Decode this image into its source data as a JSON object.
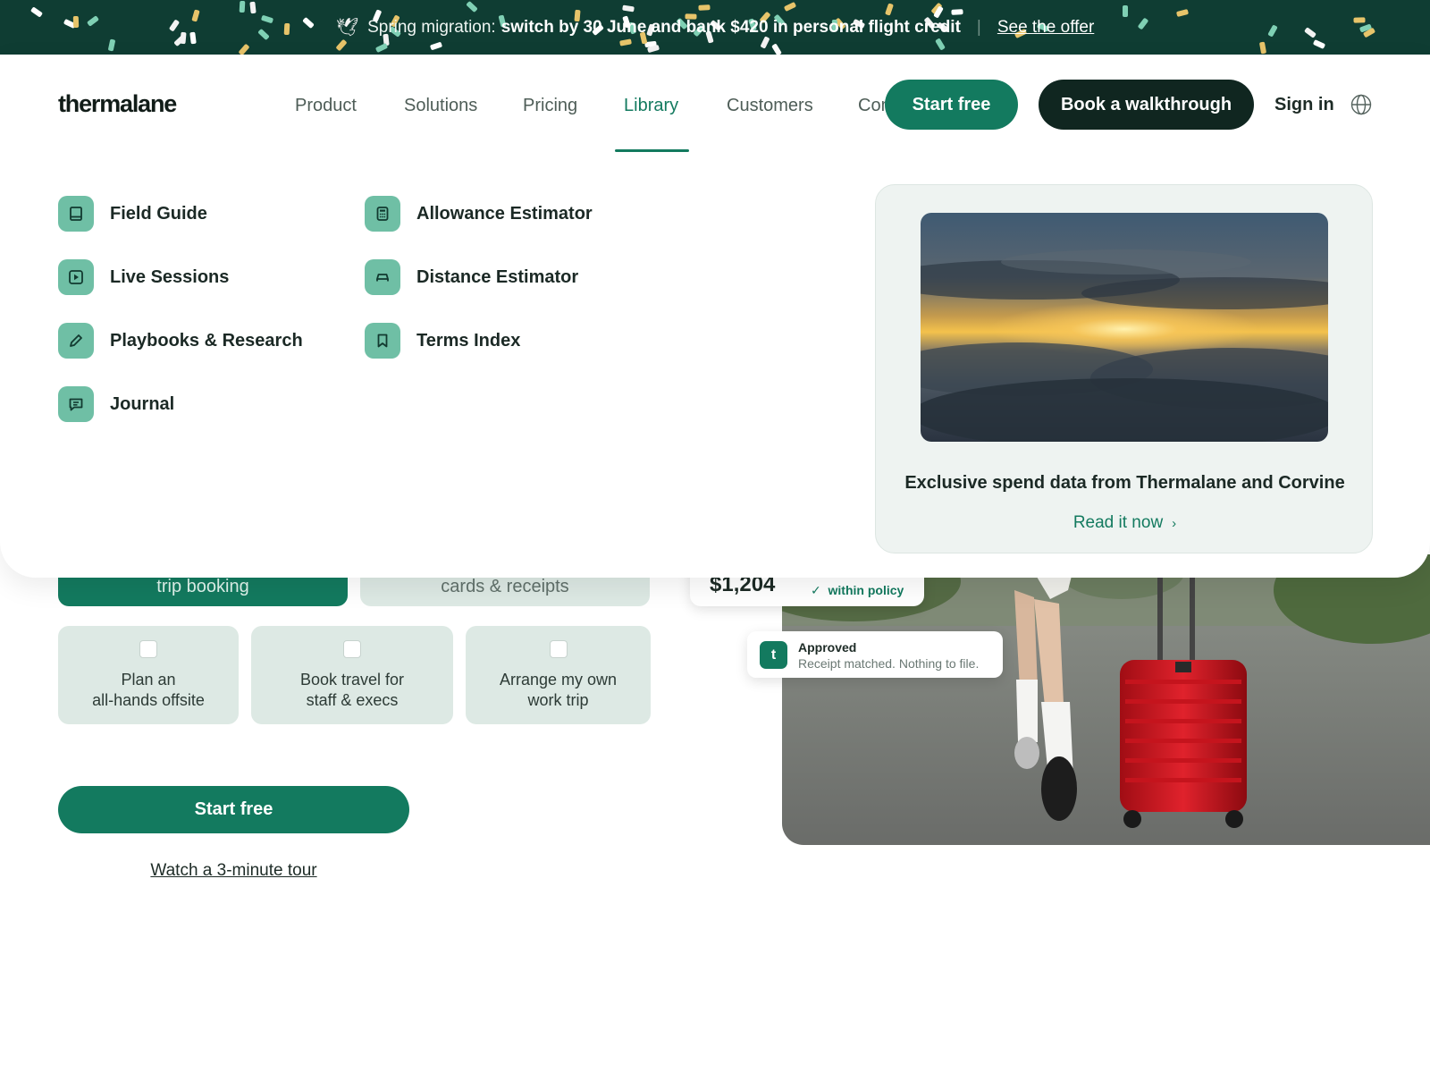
{
  "banner": {
    "icon": "dove-icon",
    "lead": "Spring migration:",
    "message": "switch by 30 June and bank $420 in personal flight credit",
    "separator": "|",
    "link": "See the offer"
  },
  "header": {
    "logo": "thermalane",
    "nav": [
      "Product",
      "Solutions",
      "Pricing",
      "Library",
      "Customers",
      "Company"
    ],
    "active_nav": "Library",
    "start_free": "Start free",
    "book_walkthrough": "Book a walkthrough",
    "sign_in": "Sign in",
    "language_icon": "globe-icon"
  },
  "library_menu": {
    "column_1": [
      {
        "label": "Field Guide",
        "icon": "book-icon"
      },
      {
        "label": "Live Sessions",
        "icon": "play-icon"
      },
      {
        "label": "Playbooks & Research",
        "icon": "pencil-icon"
      },
      {
        "label": "Journal",
        "icon": "chat-icon"
      }
    ],
    "column_2": [
      {
        "label": "Allowance Estimator",
        "icon": "calculator-icon"
      },
      {
        "label": "Distance Estimator",
        "icon": "car-icon"
      },
      {
        "label": "Terms Index",
        "icon": "bookmark-icon"
      }
    ],
    "feature": {
      "image": "sunset-above-clouds",
      "title": "Exclusive spend data from Thermalane and Corvine",
      "link": "Read it now"
    }
  },
  "hero": {
    "tabs": [
      "trip booking",
      "cards & receipts"
    ],
    "choices": [
      [
        "Plan an",
        "all-hands offsite"
      ],
      [
        "Book travel for",
        "staff & execs"
      ],
      [
        "Arrange my own",
        "work trip"
      ]
    ],
    "cta": "Start free",
    "tour_link": "Watch a 3-minute tour",
    "photo": "traveler-with-red-suitcase",
    "amount_card": {
      "amount": "$1,204",
      "status": "within policy"
    },
    "approved_card": {
      "avatar": "t",
      "title": "Approved",
      "subtitle": "Receipt matched. Nothing to file."
    }
  },
  "colors": {
    "brand": "#137a5f",
    "banner_bg": "#0f3d33",
    "dark_button": "#102620",
    "icon_tile": "#6fbfa5",
    "feature_bg": "#eef3f1",
    "hero_tile": "#dde9e4"
  }
}
